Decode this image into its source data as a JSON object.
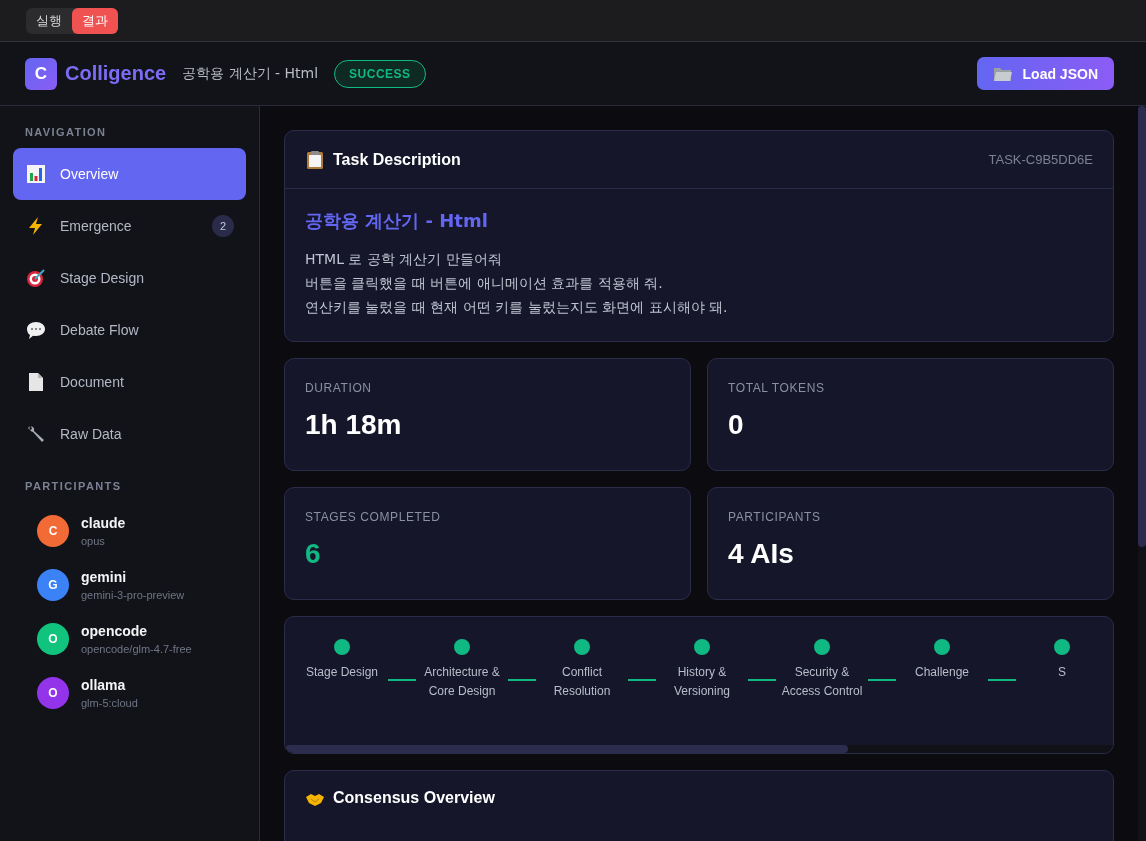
{
  "mode_tabs": [
    {
      "label": "실행",
      "selected": false
    },
    {
      "label": "결과",
      "selected": true
    }
  ],
  "header": {
    "logo_letter": "C",
    "app_name": "Colligence",
    "task_title": "공학용 계산기 - Html",
    "status": "SUCCESS",
    "load_button": "Load JSON"
  },
  "sidebar": {
    "navigation_title": "NAVIGATION",
    "items": [
      {
        "label": "Overview",
        "kind": "chart",
        "selected": true
      },
      {
        "label": "Emergence",
        "kind": "bolt",
        "selected": false,
        "badge": "2"
      },
      {
        "label": "Stage Design",
        "kind": "target",
        "selected": false
      },
      {
        "label": "Debate Flow",
        "kind": "speech",
        "selected": false
      },
      {
        "label": "Document",
        "kind": "page",
        "selected": false
      },
      {
        "label": "Raw Data",
        "kind": "wrench",
        "selected": false
      }
    ],
    "participants_title": "PARTICIPANTS",
    "participants": [
      {
        "initial": "C",
        "name": "claude",
        "model": "opus",
        "color": "#f26b36"
      },
      {
        "initial": "G",
        "name": "gemini",
        "model": "gemini-3-pro-preview",
        "color": "#3b82f6"
      },
      {
        "initial": "O",
        "name": "opencode",
        "model": "opencode/glm-4.7-free",
        "color": "#10c47e"
      },
      {
        "initial": "O",
        "name": "ollama",
        "model": "glm-5:cloud",
        "color": "#9333ea"
      }
    ]
  },
  "task_description": {
    "title": "Task Description",
    "task_id": "TASK-C9B5DD6E",
    "heading": "공학용 계산기 - Html",
    "lines": [
      "HTML 로 공학 계산기 만들어줘",
      "버튼을 클릭했을 때 버튼에 애니메이션 효과를 적용해 줘.",
      "연산키를 눌렀을 때 현재 어떤 키를 눌렀는지도 화면에 표시해야 돼."
    ]
  },
  "stats": [
    {
      "label": "DURATION",
      "value": "1h 18m",
      "accent": false
    },
    {
      "label": "TOTAL TOKENS",
      "value": "0",
      "accent": false
    },
    {
      "label": "STAGES COMPLETED",
      "value": "6",
      "accent": true
    },
    {
      "label": "PARTICIPANTS",
      "value": "4 AIs",
      "accent": false
    }
  ],
  "stages": [
    {
      "label": "Stage Design",
      "completed": true
    },
    {
      "label": "Architecture & Core Design",
      "completed": true
    },
    {
      "label": "Conflict Resolution",
      "completed": true
    },
    {
      "label": "History & Versioning",
      "completed": true
    },
    {
      "label": "Security & Access Control",
      "completed": true
    },
    {
      "label": "Challenge",
      "completed": true
    },
    {
      "label": "S",
      "completed": true
    }
  ],
  "consensus": {
    "title": "Consensus Overview"
  }
}
